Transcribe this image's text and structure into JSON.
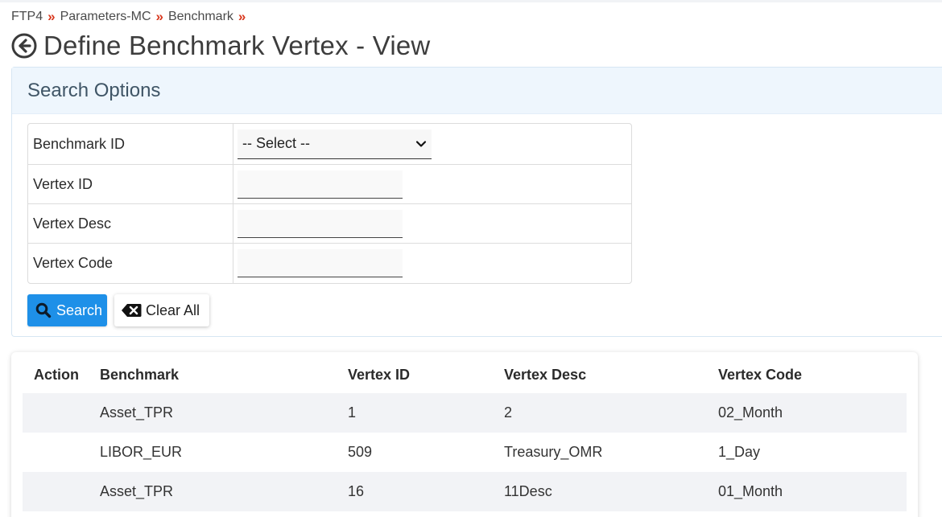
{
  "breadcrumb": [
    "FTP4",
    "Parameters-MC",
    "Benchmark"
  ],
  "breadcrumb_separator": "»",
  "page_title": "Define Benchmark Vertex - View",
  "search_panel": {
    "title": "Search Options",
    "fields": [
      {
        "label": "Benchmark ID",
        "type": "select",
        "value": "-- Select --"
      },
      {
        "label": "Vertex ID",
        "type": "text",
        "value": ""
      },
      {
        "label": "Vertex Desc",
        "type": "text",
        "value": ""
      },
      {
        "label": "Vertex Code",
        "type": "text",
        "value": ""
      }
    ],
    "search_button": "Search",
    "clear_button": "Clear All"
  },
  "results": {
    "columns": [
      "Action",
      "Benchmark",
      "Vertex ID",
      "Vertex Desc",
      "Vertex Code"
    ],
    "rows": [
      {
        "action": "",
        "benchmark": "Asset_TPR",
        "vertex_id": "1",
        "vertex_desc": "2",
        "vertex_code": "02_Month"
      },
      {
        "action": "",
        "benchmark": "LIBOR_EUR",
        "vertex_id": "509",
        "vertex_desc": "Treasury_OMR",
        "vertex_code": "1_Day"
      },
      {
        "action": "",
        "benchmark": "Asset_TPR",
        "vertex_id": "16",
        "vertex_desc": "11Desc",
        "vertex_code": "01_Month"
      }
    ]
  },
  "colors": {
    "accent": "#1e90e8",
    "breadcrumb_separator": "#d9381e",
    "panel_header_bg": "#eef6fd",
    "row_stripe": "#f2f3f6"
  },
  "icons": {
    "back": "circle-arrow-left-icon",
    "search": "magnifier-icon",
    "clear": "backspace-x-icon",
    "select": "chevron-down-icon"
  }
}
